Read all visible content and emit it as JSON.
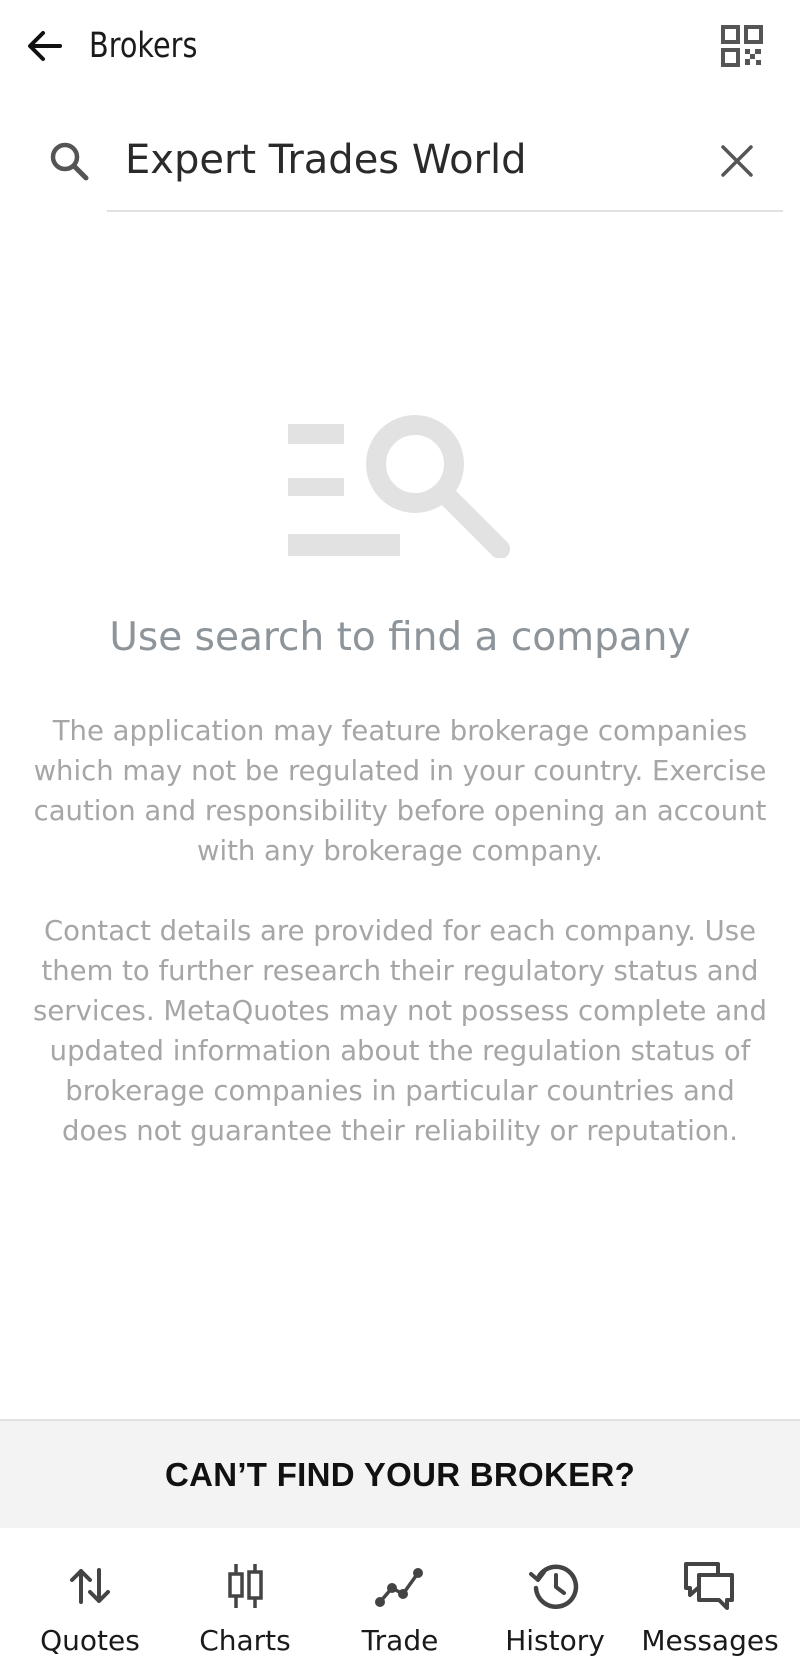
{
  "header": {
    "title": "Brokers",
    "back_icon": "arrow-left-icon",
    "qr_icon": "qr-code-icon"
  },
  "search": {
    "value": "Expert Trades World",
    "icon": "search-icon",
    "clear_icon": "close-icon"
  },
  "empty_state": {
    "icon": "search-list-icon",
    "title": "Use search to find a company",
    "paragraph1": "The application may feature brokerage companies which may not be regulated in your country. Exercise caution and responsibility before opening an account with any brokerage company.",
    "paragraph2": "Contact details are provided for each company. Use them to further research their regulatory status and services. MetaQuotes may not possess complete and updated information about the regulation status of brokerage companies in particular countries and does not guarantee their reliability or reputation."
  },
  "cta": {
    "label": "CAN’T FIND YOUR BROKER?"
  },
  "tabs": [
    {
      "label": "Quotes",
      "icon": "quotes-arrows-icon"
    },
    {
      "label": "Charts",
      "icon": "candlestick-chart-icon"
    },
    {
      "label": "Trade",
      "icon": "trade-line-icon"
    },
    {
      "label": "History",
      "icon": "history-clock-icon"
    },
    {
      "label": "Messages",
      "icon": "messages-chat-icon"
    }
  ],
  "colors": {
    "text_primary": "#1a1a1a",
    "text_muted": "#a6a6a6",
    "title_muted": "#8d949a",
    "icon_placeholder": "#e2e2e2",
    "cta_background": "#f3f3f3"
  }
}
